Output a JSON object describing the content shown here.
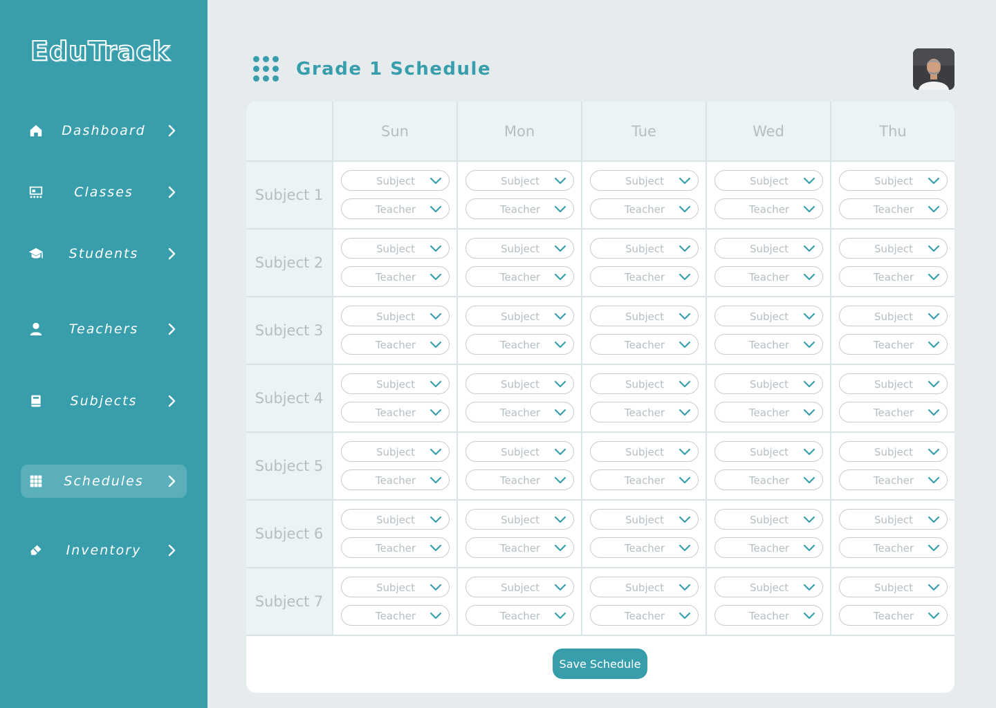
{
  "app": {
    "name": "EduTrack"
  },
  "colors": {
    "primary": "#389eab",
    "background": "#e6ebee",
    "header_cell": "#ebf3f4",
    "muted_text": "#b4bec3"
  },
  "sidebar": {
    "items": [
      {
        "label": "Dashboard",
        "icon": "home-icon",
        "active": false
      },
      {
        "label": "Classes",
        "icon": "classroom-icon",
        "active": false
      },
      {
        "label": "Students",
        "icon": "graduation-cap-icon",
        "active": false
      },
      {
        "label": "Teachers",
        "icon": "person-icon",
        "active": false
      },
      {
        "label": "Subjects",
        "icon": "book-icon",
        "active": false
      },
      {
        "label": "Schedules",
        "icon": "grid-icon",
        "active": true
      },
      {
        "label": "Inventory",
        "icon": "eraser-icon",
        "active": false
      }
    ]
  },
  "header": {
    "title": "Grade 1 Schedule",
    "avatar_icon": "user-avatar"
  },
  "schedule": {
    "days": [
      "Sun",
      "Mon",
      "Tue",
      "Wed",
      "Thu"
    ],
    "rows": [
      "Subject 1",
      "Subject 2",
      "Subject 3",
      "Subject 4",
      "Subject 5",
      "Subject 6",
      "Subject 7"
    ],
    "subject_placeholder": "Subject",
    "teacher_placeholder": "Teacher"
  },
  "actions": {
    "save_label": "Save Schedule"
  }
}
